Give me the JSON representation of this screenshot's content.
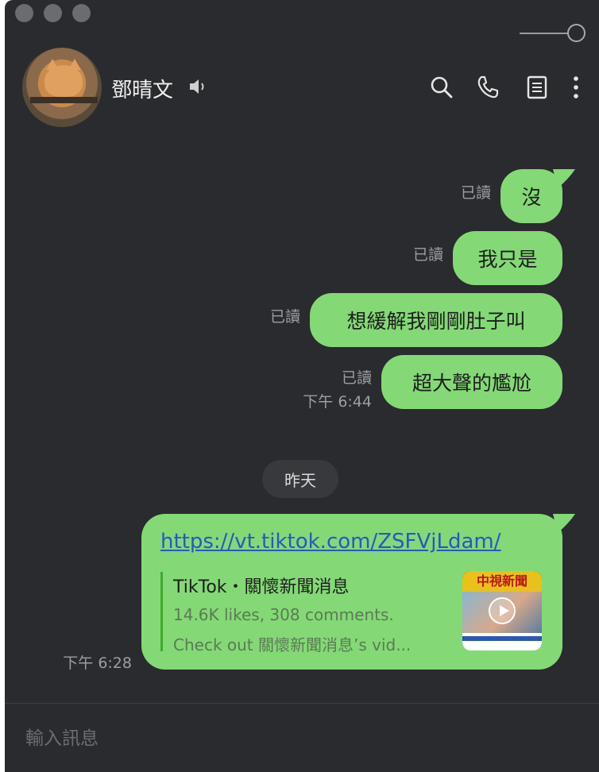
{
  "header": {
    "contact_name": "鄧晴文",
    "icons": [
      "speaker-icon",
      "search-icon",
      "phone-icon",
      "notes-icon",
      "more-vertical-icon"
    ]
  },
  "messages": [
    {
      "text": "沒",
      "read": "已讀"
    },
    {
      "text": "我只是",
      "read": "已讀"
    },
    {
      "text": "想緩解我剛剛肚子叫",
      "read": "已讀"
    },
    {
      "text": "超大聲的尷尬",
      "read": "已讀",
      "time": "下午 6:44"
    }
  ],
  "date_separator": "昨天",
  "link_message": {
    "url": "https://vt.tiktok.com/ZSFVjLdam/",
    "preview_title": "TikTok・關懷新聞消息",
    "preview_line1": "14.6K likes, 308 comments.",
    "preview_line2": "Check out 關懷新聞消息’s vid...",
    "thumbnail_banner": "中視新聞",
    "time": "下午 6:28"
  },
  "input": {
    "placeholder": "輸入訊息"
  },
  "colors": {
    "bubble": "#84d976",
    "background": "#2a2b2e",
    "link": "#2a56c6"
  }
}
